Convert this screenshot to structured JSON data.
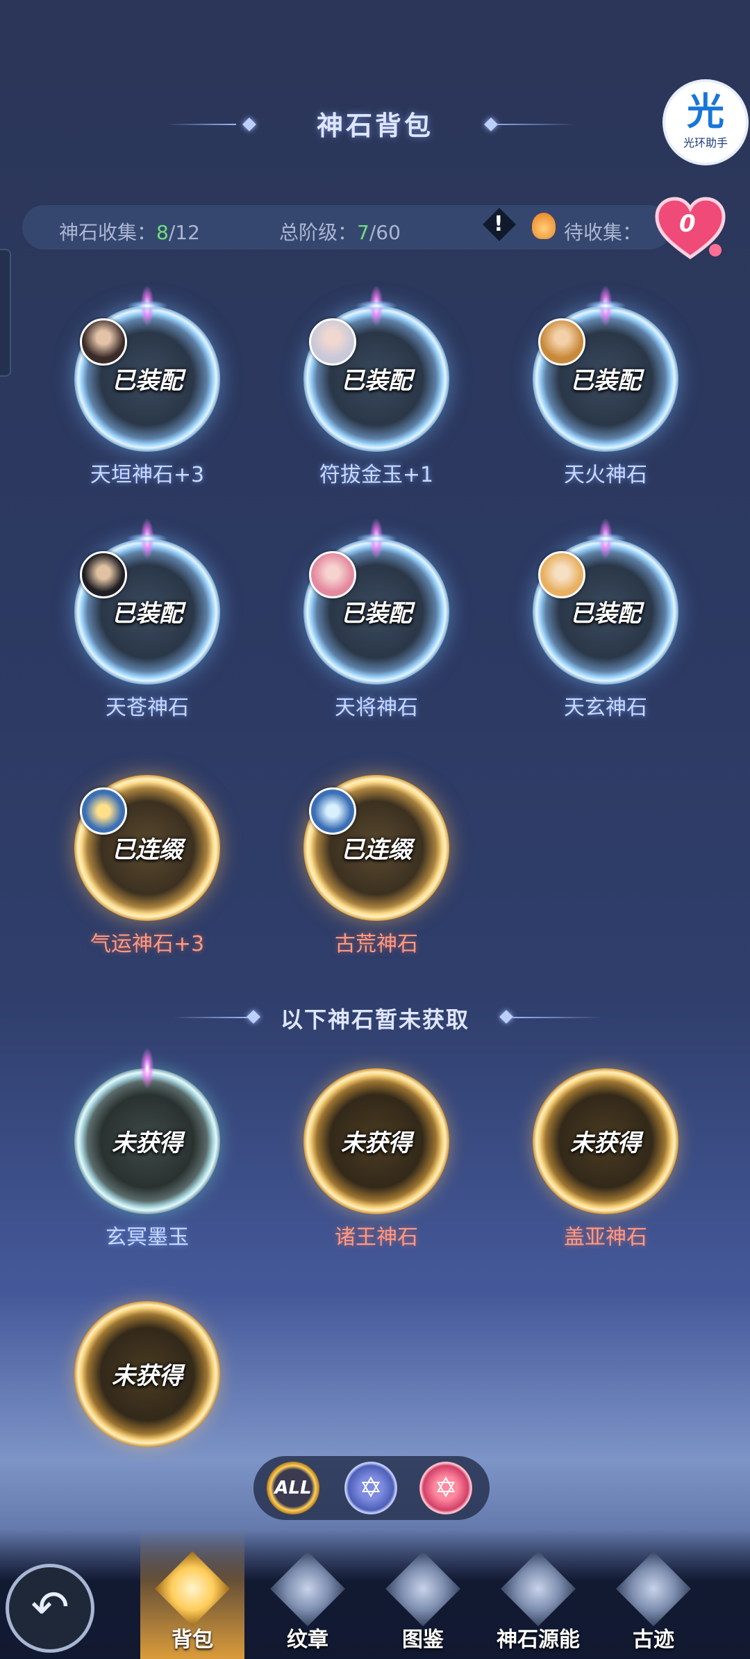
{
  "header": {
    "title": "神石背包",
    "helper_label": "光环助手",
    "helper_glyph": "光"
  },
  "stats": {
    "collect_label": "神石收集：",
    "collect_value": "8",
    "collect_total": "/12",
    "tier_label": "总阶级：",
    "tier_value": "7",
    "tier_total": "/60",
    "pending_label": "待收集：",
    "heart_count": "0"
  },
  "owned_stones": [
    {
      "name": "天垣神石+3",
      "state": "已装配"
    },
    {
      "name": "符拔金玉+1",
      "state": "已装配"
    },
    {
      "name": "天火神石",
      "state": "已装配"
    },
    {
      "name": "天苍神石",
      "state": "已装配"
    },
    {
      "name": "天将神石",
      "state": "已装配"
    },
    {
      "name": "天玄神石",
      "state": "已装配"
    },
    {
      "name": "气运神石+3",
      "state": "已连缀"
    },
    {
      "name": "古荒神石",
      "state": "已连缀"
    }
  ],
  "divider_text": "以下神石暂未获取",
  "unowned_stones": [
    {
      "name": "玄冥墨玉",
      "state": "未获得"
    },
    {
      "name": "诸王神石",
      "state": "未获得"
    },
    {
      "name": "盖亚神石",
      "state": "未获得"
    },
    {
      "name": "",
      "state": "未获得"
    }
  ],
  "filters": {
    "all_label": "ALL"
  },
  "nav": [
    {
      "label": "背包",
      "icon": "backpack-icon"
    },
    {
      "label": "纹章",
      "icon": "emblem-icon"
    },
    {
      "label": "图鉴",
      "icon": "catalog-icon"
    },
    {
      "label": "神石源能",
      "icon": "source-energy-icon"
    },
    {
      "label": "古迹",
      "icon": "relic-icon"
    }
  ],
  "colors": {
    "collected_value": "#6ee07a",
    "equipped_name": "#c9d9ff",
    "linked_name": "#ff9a82"
  }
}
